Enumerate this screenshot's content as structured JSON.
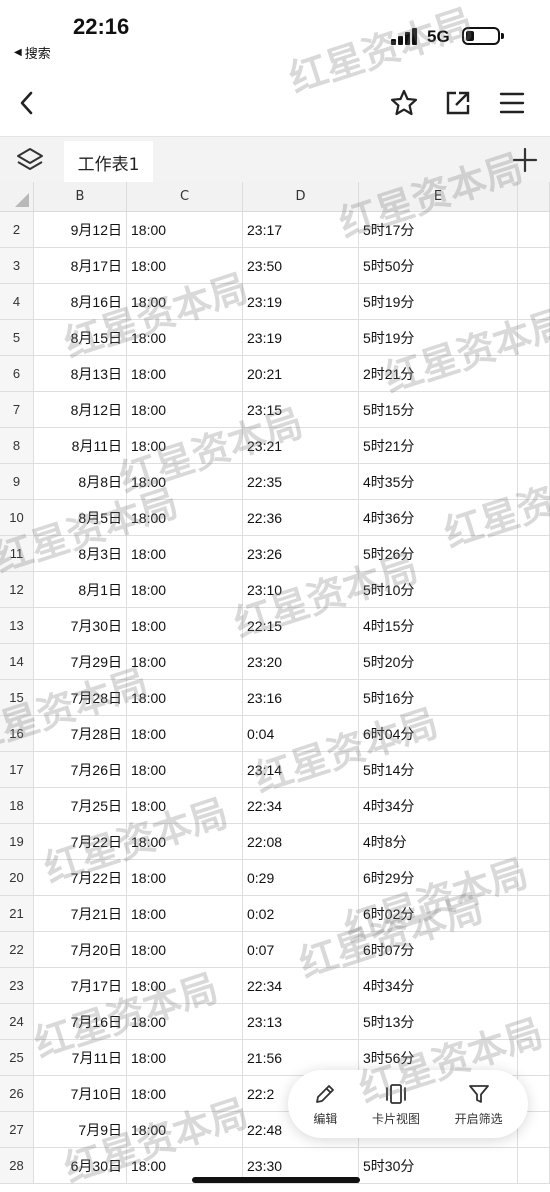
{
  "status": {
    "time": "22:16",
    "back_app": "搜索",
    "network": "5G"
  },
  "sheet": {
    "tab_label": "工作表1"
  },
  "columns": [
    "B",
    "C",
    "D",
    "E"
  ],
  "rows": [
    {
      "num": "2",
      "b": "9月12日",
      "c": "18:00",
      "d": "23:17",
      "e": "5时17分"
    },
    {
      "num": "3",
      "b": "8月17日",
      "c": "18:00",
      "d": "23:50",
      "e": "5时50分"
    },
    {
      "num": "4",
      "b": "8月16日",
      "c": "18:00",
      "d": "23:19",
      "e": "5时19分"
    },
    {
      "num": "5",
      "b": "8月15日",
      "c": "18:00",
      "d": "23:19",
      "e": "5时19分"
    },
    {
      "num": "6",
      "b": "8月13日",
      "c": "18:00",
      "d": "20:21",
      "e": "2时21分"
    },
    {
      "num": "7",
      "b": "8月12日",
      "c": "18:00",
      "d": "23:15",
      "e": "5时15分"
    },
    {
      "num": "8",
      "b": "8月11日",
      "c": "18:00",
      "d": "23:21",
      "e": "5时21分"
    },
    {
      "num": "9",
      "b": "8月8日",
      "c": "18:00",
      "d": "22:35",
      "e": "4时35分"
    },
    {
      "num": "10",
      "b": "8月5日",
      "c": "18:00",
      "d": "22:36",
      "e": "4时36分"
    },
    {
      "num": "11",
      "b": "8月3日",
      "c": "18:00",
      "d": "23:26",
      "e": "5时26分"
    },
    {
      "num": "12",
      "b": "8月1日",
      "c": "18:00",
      "d": "23:10",
      "e": "5时10分"
    },
    {
      "num": "13",
      "b": "7月30日",
      "c": "18:00",
      "d": "22:15",
      "e": "4时15分"
    },
    {
      "num": "14",
      "b": "7月29日",
      "c": "18:00",
      "d": "23:20",
      "e": "5时20分"
    },
    {
      "num": "15",
      "b": "7月28日",
      "c": "18:00",
      "d": "23:16",
      "e": "5时16分"
    },
    {
      "num": "16",
      "b": "7月28日",
      "c": "18:00",
      "d": "0:04",
      "e": "6时04分"
    },
    {
      "num": "17",
      "b": "7月26日",
      "c": "18:00",
      "d": "23:14",
      "e": "5时14分"
    },
    {
      "num": "18",
      "b": "7月25日",
      "c": "18:00",
      "d": "22:34",
      "e": "4时34分"
    },
    {
      "num": "19",
      "b": "7月22日",
      "c": "18:00",
      "d": "22:08",
      "e": "4时8分"
    },
    {
      "num": "20",
      "b": "7月22日",
      "c": "18:00",
      "d": "0:29",
      "e": "6时29分"
    },
    {
      "num": "21",
      "b": "7月21日",
      "c": "18:00",
      "d": "0:02",
      "e": "6时02分"
    },
    {
      "num": "22",
      "b": "7月20日",
      "c": "18:00",
      "d": "0:07",
      "e": "6时07分"
    },
    {
      "num": "23",
      "b": "7月17日",
      "c": "18:00",
      "d": "22:34",
      "e": "4时34分"
    },
    {
      "num": "24",
      "b": "7月16日",
      "c": "18:00",
      "d": "23:13",
      "e": "5时13分"
    },
    {
      "num": "25",
      "b": "7月11日",
      "c": "18:00",
      "d": "21:56",
      "e": "3时56分"
    },
    {
      "num": "26",
      "b": "7月10日",
      "c": "18:00",
      "d": "22:2",
      "e": ""
    },
    {
      "num": "27",
      "b": "7月9日",
      "c": "18:00",
      "d": "22:48",
      "e": ""
    },
    {
      "num": "28",
      "b": "6月30日",
      "c": "18:00",
      "d": "23:30",
      "e": "5时30分"
    }
  ],
  "toolbar": {
    "edit": "编辑",
    "card_view": "卡片视图",
    "filter": "开启筛选"
  },
  "watermark": "红星资本局",
  "icons": {
    "back": "chevron-left-icon",
    "star": "star-icon",
    "share": "share-icon",
    "menu": "hamburger-menu-icon",
    "layers": "layers-icon",
    "add": "plus-icon",
    "edit": "pencil-icon",
    "card": "card-view-icon",
    "filter": "funnel-icon"
  }
}
